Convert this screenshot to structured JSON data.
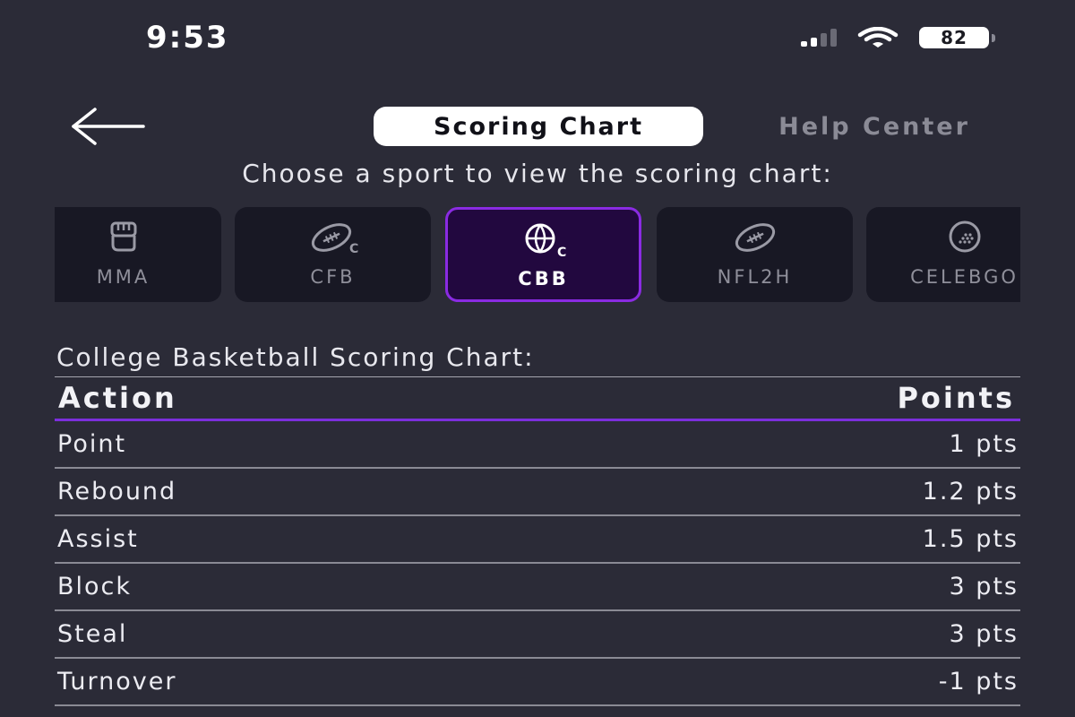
{
  "status_bar": {
    "time": "9:53",
    "battery": "82"
  },
  "header": {
    "back_icon": "arrow-left-icon",
    "active_tab": "Scoring Chart",
    "inactive_tab": "Help Center"
  },
  "prompt": "Choose a sport to view the scoring chart:",
  "sports": [
    {
      "label": "MMA",
      "icon": "mma-glove-icon",
      "selected": false
    },
    {
      "label": "CFB",
      "icon": "college-football-icon",
      "selected": false
    },
    {
      "label": "CBB",
      "icon": "college-basketball-icon",
      "selected": true
    },
    {
      "label": "NFL2H",
      "icon": "football-icon",
      "selected": false
    },
    {
      "label": "CELEBGO",
      "icon": "golf-ball-icon",
      "selected": false
    }
  ],
  "chart": {
    "title": "College Basketball Scoring Chart:",
    "columns": [
      "Action",
      "Points"
    ],
    "rows": [
      {
        "action": "Point",
        "points": "1 pts"
      },
      {
        "action": "Rebound",
        "points": "1.2 pts"
      },
      {
        "action": "Assist",
        "points": "1.5 pts"
      },
      {
        "action": "Block",
        "points": "3 pts"
      },
      {
        "action": "Steal",
        "points": "3 pts"
      },
      {
        "action": "Turnover",
        "points": "-1 pts"
      }
    ]
  },
  "colors": {
    "background": "#2b2b37",
    "card": "#181824",
    "accent": "#8a2be2",
    "selected_card": "#22083f"
  }
}
